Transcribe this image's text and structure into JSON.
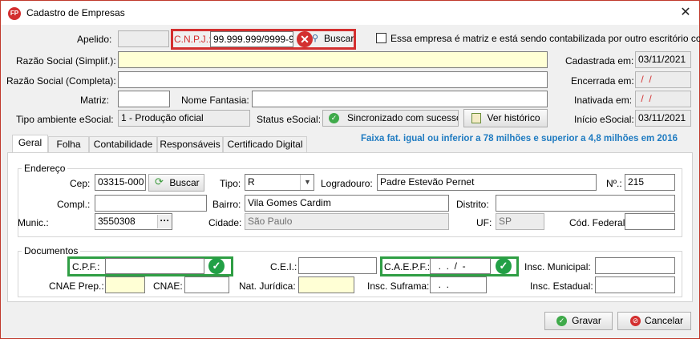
{
  "window": {
    "title": "Cadastro de Empresas",
    "app_badge": "FP"
  },
  "header": {
    "apelido_label": "Apelido:",
    "cnpj_label": "C.N.P.J.:",
    "cnpj_value": "99.999.999/9999-99",
    "buscar_label": "Buscar",
    "matriz_check_label": "Essa empresa é matriz e está sendo contabilizada por outro escritório con",
    "razao_simpl_label": "Razão Social (Simplif.):",
    "razao_comp_label": "Razão Social (Completa):",
    "matriz_label": "Matriz:",
    "fantasia_label": "Nome Fantasia:",
    "tipo_amb_label": "Tipo ambiente eSocial:",
    "tipo_amb_value": "1 - Produção oficial",
    "status_label": "Status eSocial:",
    "status_value": "Sincronizado com sucesso",
    "historico_label": "Ver histórico",
    "cadastrada_label": "Cadastrada em:",
    "cadastrada_value": "03/11/2021",
    "encerrada_label": "Encerrada em:",
    "encerrada_value": " /  /",
    "inativada_label": "Inativada em:",
    "inativada_value": " /  /",
    "inicio_label": "Início eSocial:",
    "inicio_value": "03/11/2021"
  },
  "tabs": [
    "Geral",
    "Folha",
    "Contabilidade",
    "Responsáveis",
    "Certificado Digital"
  ],
  "notice": "Faixa fat. igual ou inferior a 78 milhões e superior a 4,8 milhões em 2016",
  "endereco": {
    "title": "Endereço",
    "cep_label": "Cep:",
    "cep_value": "03315-000",
    "buscar_label": "Buscar",
    "tipo_label": "Tipo:",
    "tipo_value": "R",
    "logradouro_label": "Logradouro:",
    "logradouro_value": "Padre Estevão Pernet",
    "numero_label": "Nº.:",
    "numero_value": "215",
    "compl_label": "Compl.:",
    "bairro_label": "Bairro:",
    "bairro_value": "Vila Gomes Cardim",
    "distrito_label": "Distrito:",
    "munic_label": "Munic.:",
    "munic_value": "3550308",
    "cidade_label": "Cidade:",
    "cidade_value": "São Paulo",
    "uf_label": "UF:",
    "uf_value": "SP",
    "cod_federal_label": "Cód. Federal:"
  },
  "documentos": {
    "title": "Documentos",
    "cpf_label": "C.P.F.:",
    "cei_label": "C.E.I.:",
    "caepf_label": "C.A.E.P.F.:",
    "caepf_value": "  .  .  /  -",
    "insc_municipal_label": "Insc. Municipal:",
    "cnae_prep_label": "CNAE Prep.:",
    "cnae_label": "CNAE:",
    "nat_juridica_label": "Nat. Jurídica:",
    "insc_suframa_label": "Insc. Suframa:",
    "insc_suframa_value": "  .  .",
    "insc_estadual_label": "Insc. Estadual:"
  },
  "footer": {
    "gravar_label": "Gravar",
    "cancelar_label": "Cancelar"
  },
  "colors": {
    "accent_red": "#d32f2f",
    "ok_green": "#22a046",
    "notice_blue": "#1f7bc1",
    "required_yellow": "#ffffd5"
  }
}
